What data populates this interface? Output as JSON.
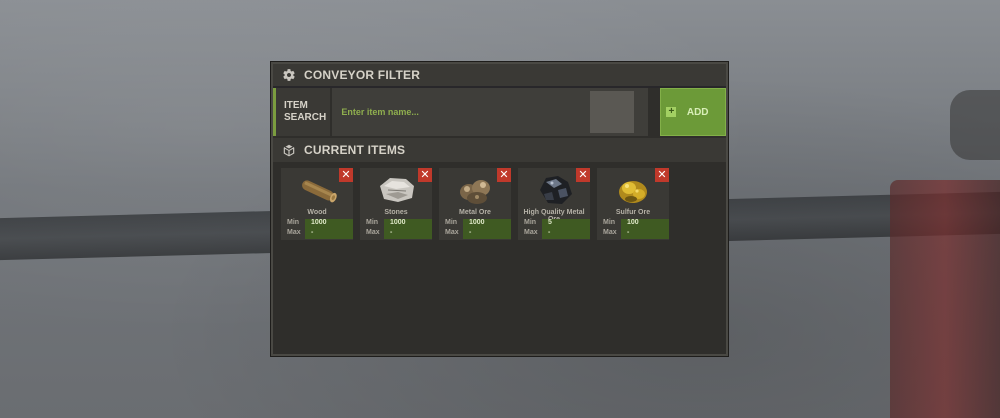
{
  "header": {
    "title": "CONVEYOR FILTER",
    "icon": "gear-icon"
  },
  "search": {
    "label_line1": "ITEM",
    "label_line2": "SEARCH",
    "placeholder": "Enter item name...",
    "add_label": "ADD"
  },
  "current_items": {
    "title": "CURRENT ITEMS",
    "icon": "box-icon"
  },
  "items": [
    {
      "name": "Wood",
      "min_label": "Min",
      "min": "1000",
      "max_label": "Max",
      "max": "-"
    },
    {
      "name": "Stones",
      "min_label": "Min",
      "min": "1000",
      "max_label": "Max",
      "max": "-"
    },
    {
      "name": "Metal Ore",
      "min_label": "Min",
      "min": "1000",
      "max_label": "Max",
      "max": "-"
    },
    {
      "name": "High Quality Metal Ore",
      "min_label": "Min",
      "min": "5",
      "max_label": "Max",
      "max": "-"
    },
    {
      "name": "Sulfur Ore",
      "min_label": "Min",
      "min": "100",
      "max_label": "Max",
      "max": "-"
    }
  ],
  "colors": {
    "accent_green": "#6c9a38",
    "remove_red": "#c0392b",
    "panel": "#2f2e2b"
  }
}
